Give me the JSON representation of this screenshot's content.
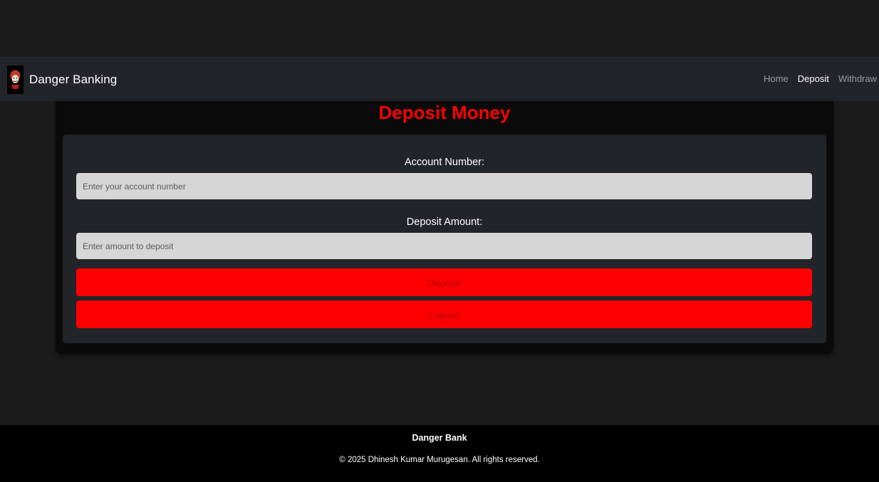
{
  "navbar": {
    "brand": "Danger Banking",
    "logo_icon": "mask-icon",
    "links": [
      {
        "label": "Home",
        "active": false
      },
      {
        "label": "Deposit",
        "active": true
      },
      {
        "label": "Withdraw",
        "active": false
      }
    ]
  },
  "main": {
    "title": "Deposit Money",
    "account_label": "Account Number:",
    "account_placeholder": "Enter your account number",
    "amount_label": "Deposit Amount:",
    "amount_placeholder": "Enter amount to deposit",
    "deposit_button": "Deposit",
    "logout_button": "Logout"
  },
  "footer": {
    "title": "Danger Bank",
    "copyright": "© 2025 Dhinesh Kumar Murugesan. All rights reserved."
  },
  "colors": {
    "accent": "#ff0000",
    "navbar_bg": "#212529",
    "page_bg": "#1b1b1b",
    "input_bg": "#d6d6d6"
  }
}
